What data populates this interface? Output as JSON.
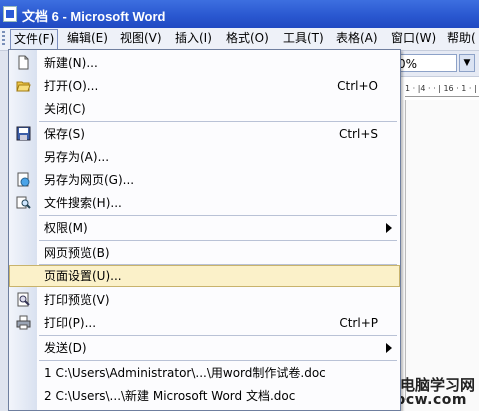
{
  "window": {
    "title": "文档 6 - Microsoft Word"
  },
  "menubar": {
    "items": [
      "文件(F)",
      "编辑(E)",
      "视图(V)",
      "插入(I)",
      "格式(O)",
      "工具(T)",
      "表格(A)",
      "窗口(W)",
      "帮助("
    ]
  },
  "toolbar": {
    "zoom_value": "0%"
  },
  "ruler": {
    "text": "1 · |4 · · | 16 · 1 · |"
  },
  "file_menu": {
    "items": [
      {
        "label": "新建(N)...",
        "shortcut": "",
        "icon": "new-document-icon"
      },
      {
        "label": "打开(O)...",
        "shortcut": "Ctrl+O",
        "icon": "open-folder-icon"
      },
      {
        "label": "关闭(C)",
        "shortcut": ""
      },
      {
        "label": "保存(S)",
        "shortcut": "Ctrl+S",
        "icon": "save-icon"
      },
      {
        "label": "另存为(A)...",
        "shortcut": ""
      },
      {
        "label": "另存为网页(G)...",
        "shortcut": "",
        "icon": "web-page-icon"
      },
      {
        "label": "文件搜索(H)...",
        "shortcut": "",
        "icon": "file-search-icon"
      },
      {
        "label": "权限(M)",
        "shortcut": "",
        "submenu": true
      },
      {
        "label": "网页预览(B)",
        "shortcut": ""
      },
      {
        "label": "页面设置(U)...",
        "shortcut": "",
        "highlighted": true
      },
      {
        "label": "打印预览(V)",
        "shortcut": "",
        "icon": "print-preview-icon"
      },
      {
        "label": "打印(P)...",
        "shortcut": "Ctrl+P",
        "icon": "printer-icon"
      },
      {
        "label": "发送(D)",
        "shortcut": "",
        "submenu": true
      },
      {
        "label": "1 C:\\Users\\Administrator\\...\\用word制作试卷.doc",
        "shortcut": ""
      },
      {
        "label": "2 C:\\Users\\...\\新建 Microsoft Word 文档.doc",
        "shortcut": ""
      }
    ]
  },
  "watermark": {
    "line1": "无忧电脑学习网",
    "line2": "wypcw.com"
  },
  "colors": {
    "titlebar": "#2a58d0",
    "highlight": "#fbf1c9",
    "menu_border": "#6f7f9f"
  }
}
